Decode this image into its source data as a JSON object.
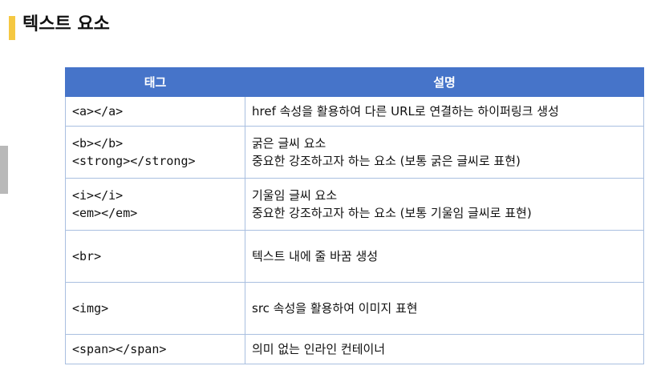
{
  "page": {
    "title": "텍스트 요소"
  },
  "table": {
    "headers": [
      "태그",
      "설명"
    ],
    "rows": [
      {
        "tag": [
          "<a></a>"
        ],
        "desc": [
          "href 속성을 활용하여 다른 URL로 연결하는 하이퍼링크 생성"
        ]
      },
      {
        "tag": [
          "<b></b>",
          "<strong></strong>"
        ],
        "desc": [
          "굵은 글씨 요소",
          "중요한 강조하고자 하는 요소 (보통 굵은 글씨로 표현)"
        ]
      },
      {
        "tag": [
          "<i></i>",
          "<em></em>"
        ],
        "desc": [
          "기울임 글씨 요소",
          "중요한 강조하고자 하는 요소 (보통 기울임 글씨로 표현)"
        ]
      },
      {
        "tag": [
          "<br>"
        ],
        "desc": [
          "텍스트 내에 줄 바꿈 생성"
        ]
      },
      {
        "tag": [
          "<img>"
        ],
        "desc": [
          "src 속성을 활용하여 이미지 표현"
        ]
      },
      {
        "tag": [
          "<span></span>"
        ],
        "desc": [
          "의미 없는 인라인 컨테이너"
        ]
      }
    ]
  },
  "colors": {
    "accent": "#f5c842",
    "header_bg": "#4674c9",
    "border": "#a9bfe0"
  }
}
